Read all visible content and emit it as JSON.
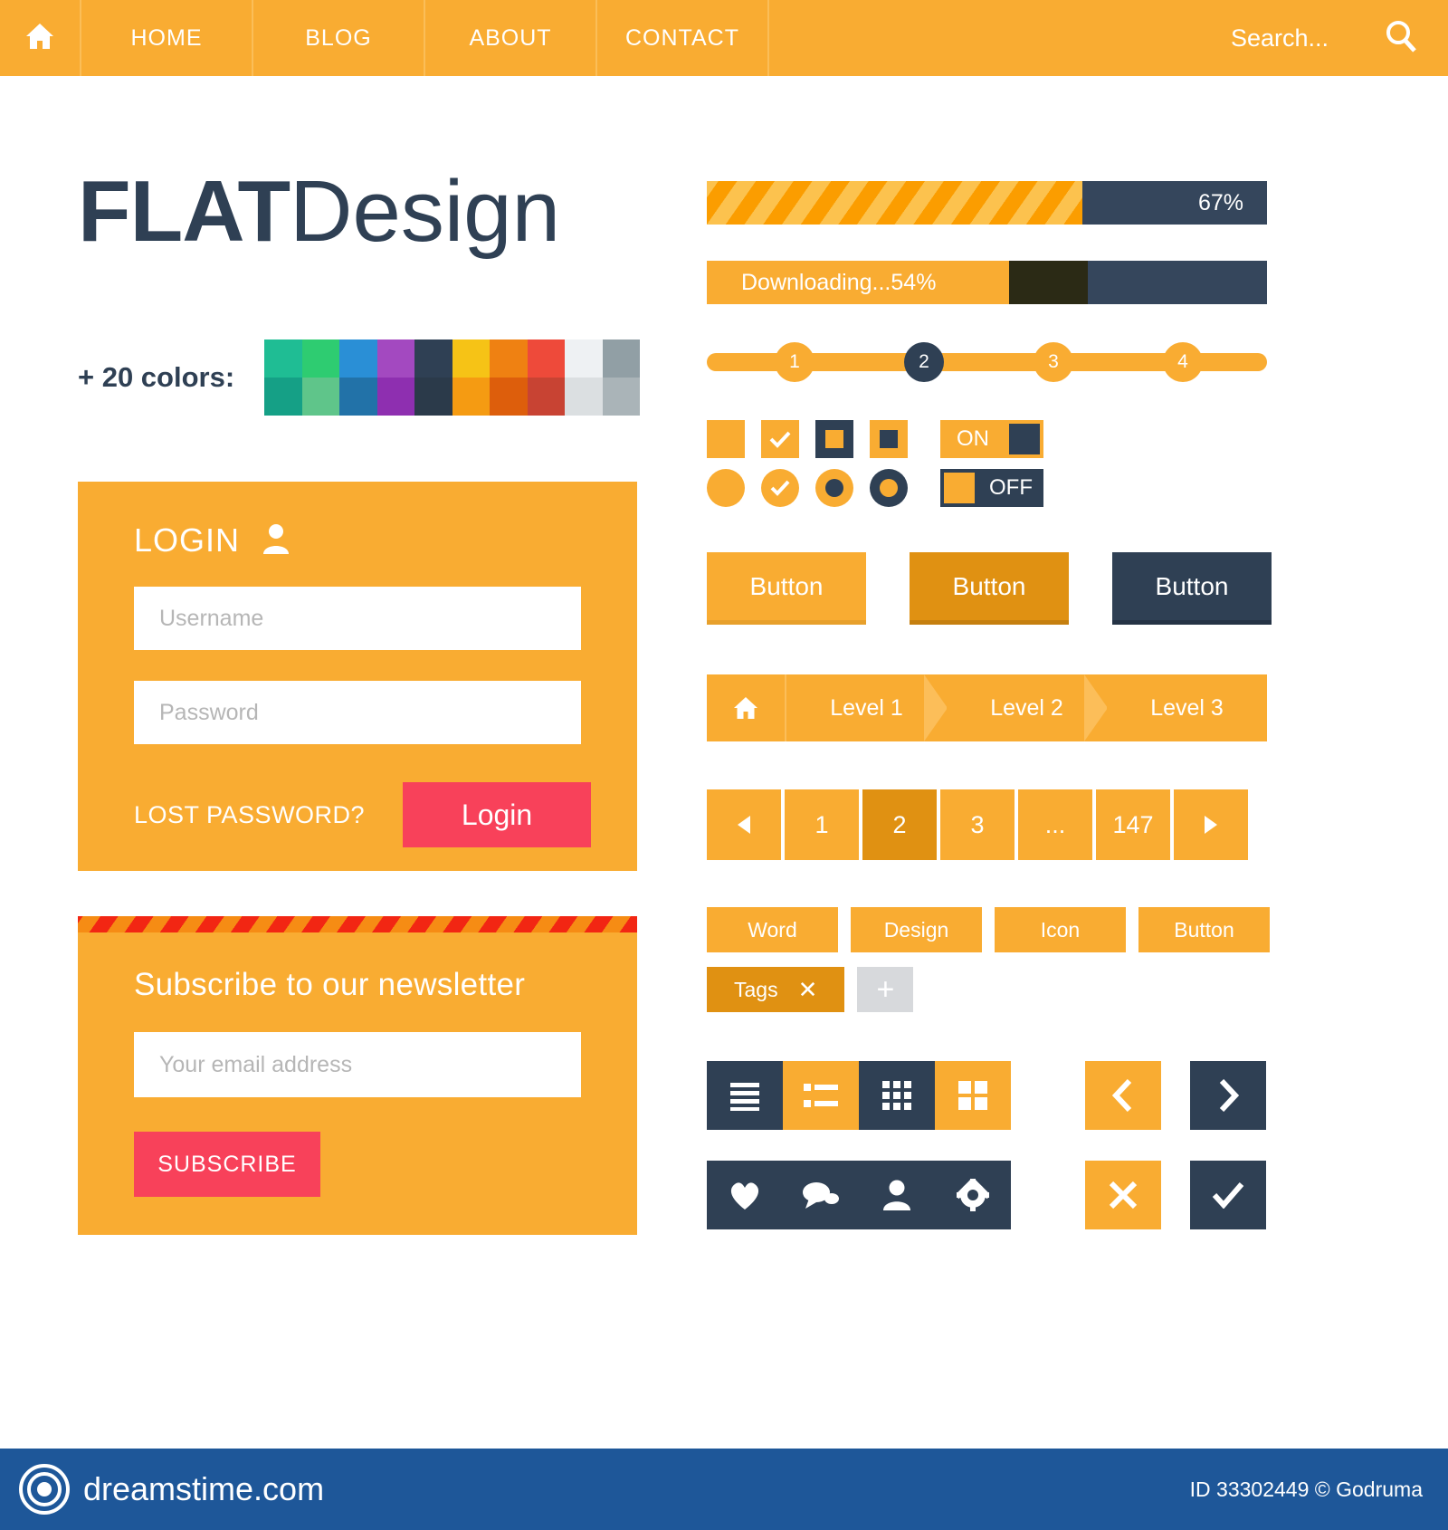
{
  "navbar": {
    "home_icon": "home-icon",
    "items": [
      {
        "label": "HOME"
      },
      {
        "label": "BLOG"
      },
      {
        "label": "ABOUT"
      },
      {
        "label": "CONTACT"
      }
    ],
    "search_placeholder": "Search...",
    "search_icon": "search-icon"
  },
  "hero": {
    "title_bold": "FLAT",
    "title_light": "Design",
    "colors_label": "+ 20 colors:",
    "palette": {
      "top": [
        "#1fbd94",
        "#2ecc71",
        "#2a8fd6",
        "#a349c0",
        "#2f4054",
        "#f6c316",
        "#ef8112",
        "#ee4a3a",
        "#eef1f3",
        "#919fa5"
      ],
      "bottom": [
        "#15a086",
        "#5fc58a",
        "#2272a8",
        "#8e2fb0",
        "#2b3a4a",
        "#f59b12",
        "#dd5e0c",
        "#c84333",
        "#dbdfe1",
        "#aab4b8"
      ]
    }
  },
  "login": {
    "title": "LOGIN",
    "user_icon": "user-icon",
    "username_placeholder": "Username",
    "password_placeholder": "Password",
    "lost_password_label": "LOST PASSWORD?",
    "login_button": "Login"
  },
  "newsletter": {
    "title": "Subscribe to our newsletter",
    "email_placeholder": "Your email address",
    "subscribe_button": "SUBSCRIBE"
  },
  "progress": {
    "striped": {
      "percent_label": "67%",
      "value": 67
    },
    "download": {
      "label": "Downloading...54%",
      "value": 54
    }
  },
  "steps": {
    "items": [
      {
        "label": "1",
        "active": false
      },
      {
        "label": "2",
        "active": true
      },
      {
        "label": "3",
        "active": false
      },
      {
        "label": "4",
        "active": false
      }
    ]
  },
  "controls": {
    "checkbox_icons": [
      "checkbox-empty",
      "checkbox-checked",
      "checkbox-dark-inner",
      "checkbox-light-inner"
    ],
    "radio_icons": [
      "radio-empty",
      "radio-checked",
      "radio-dot",
      "radio-dark-dot"
    ],
    "toggle_on_label": "ON",
    "toggle_off_label": "OFF"
  },
  "buttons": [
    {
      "label": "Button",
      "style": "light"
    },
    {
      "label": "Button",
      "style": "amber"
    },
    {
      "label": "Button",
      "style": "dark"
    }
  ],
  "breadcrumb": {
    "home_icon": "home-icon",
    "levels": [
      "Level 1",
      "Level 2",
      "Level 3"
    ]
  },
  "pagination": {
    "prev_icon": "triangle-left-icon",
    "next_icon": "triangle-right-icon",
    "pages": [
      {
        "label": "1",
        "active": false
      },
      {
        "label": "2",
        "active": true
      },
      {
        "label": "3",
        "active": false
      },
      {
        "label": "...",
        "active": false
      },
      {
        "label": "147",
        "active": false
      }
    ]
  },
  "tags": {
    "row1": [
      {
        "label": "Word",
        "selected": false
      },
      {
        "label": "Design",
        "selected": false
      },
      {
        "label": "Icon",
        "selected": false
      },
      {
        "label": "Button",
        "selected": false
      }
    ],
    "row2": [
      {
        "label": "Tags",
        "selected": true,
        "close_icon": "close-icon"
      }
    ],
    "add_label": "+"
  },
  "icon_bars": {
    "row1": [
      {
        "icon": "list-lines-icon",
        "theme": "dark"
      },
      {
        "icon": "list-bullets-icon",
        "theme": "light"
      },
      {
        "icon": "grid-dots-icon",
        "theme": "dark"
      },
      {
        "icon": "grid-tiles-icon",
        "theme": "light"
      }
    ],
    "row2": [
      {
        "icon": "heart-icon",
        "theme": "dark"
      },
      {
        "icon": "comment-icon",
        "theme": "dark"
      },
      {
        "icon": "user-icon",
        "theme": "dark"
      },
      {
        "icon": "gear-icon",
        "theme": "dark"
      }
    ],
    "nav_row1": [
      {
        "icon": "chevron-left-icon",
        "theme": "light"
      },
      {
        "icon": "chevron-right-icon",
        "theme": "dark"
      }
    ],
    "nav_row2": [
      {
        "icon": "close-icon",
        "theme": "light"
      },
      {
        "icon": "check-icon",
        "theme": "dark"
      }
    ]
  },
  "footer": {
    "brand": "dreamstime.com",
    "credit": "ID 33302449 © Godruma"
  },
  "theme": {
    "amber": "#f9ac32",
    "amber_dark": "#e09112",
    "navy": "#2f4054",
    "navy_alt": "#35465c",
    "red": "#f8415a",
    "footer_blue": "#1e5799"
  }
}
